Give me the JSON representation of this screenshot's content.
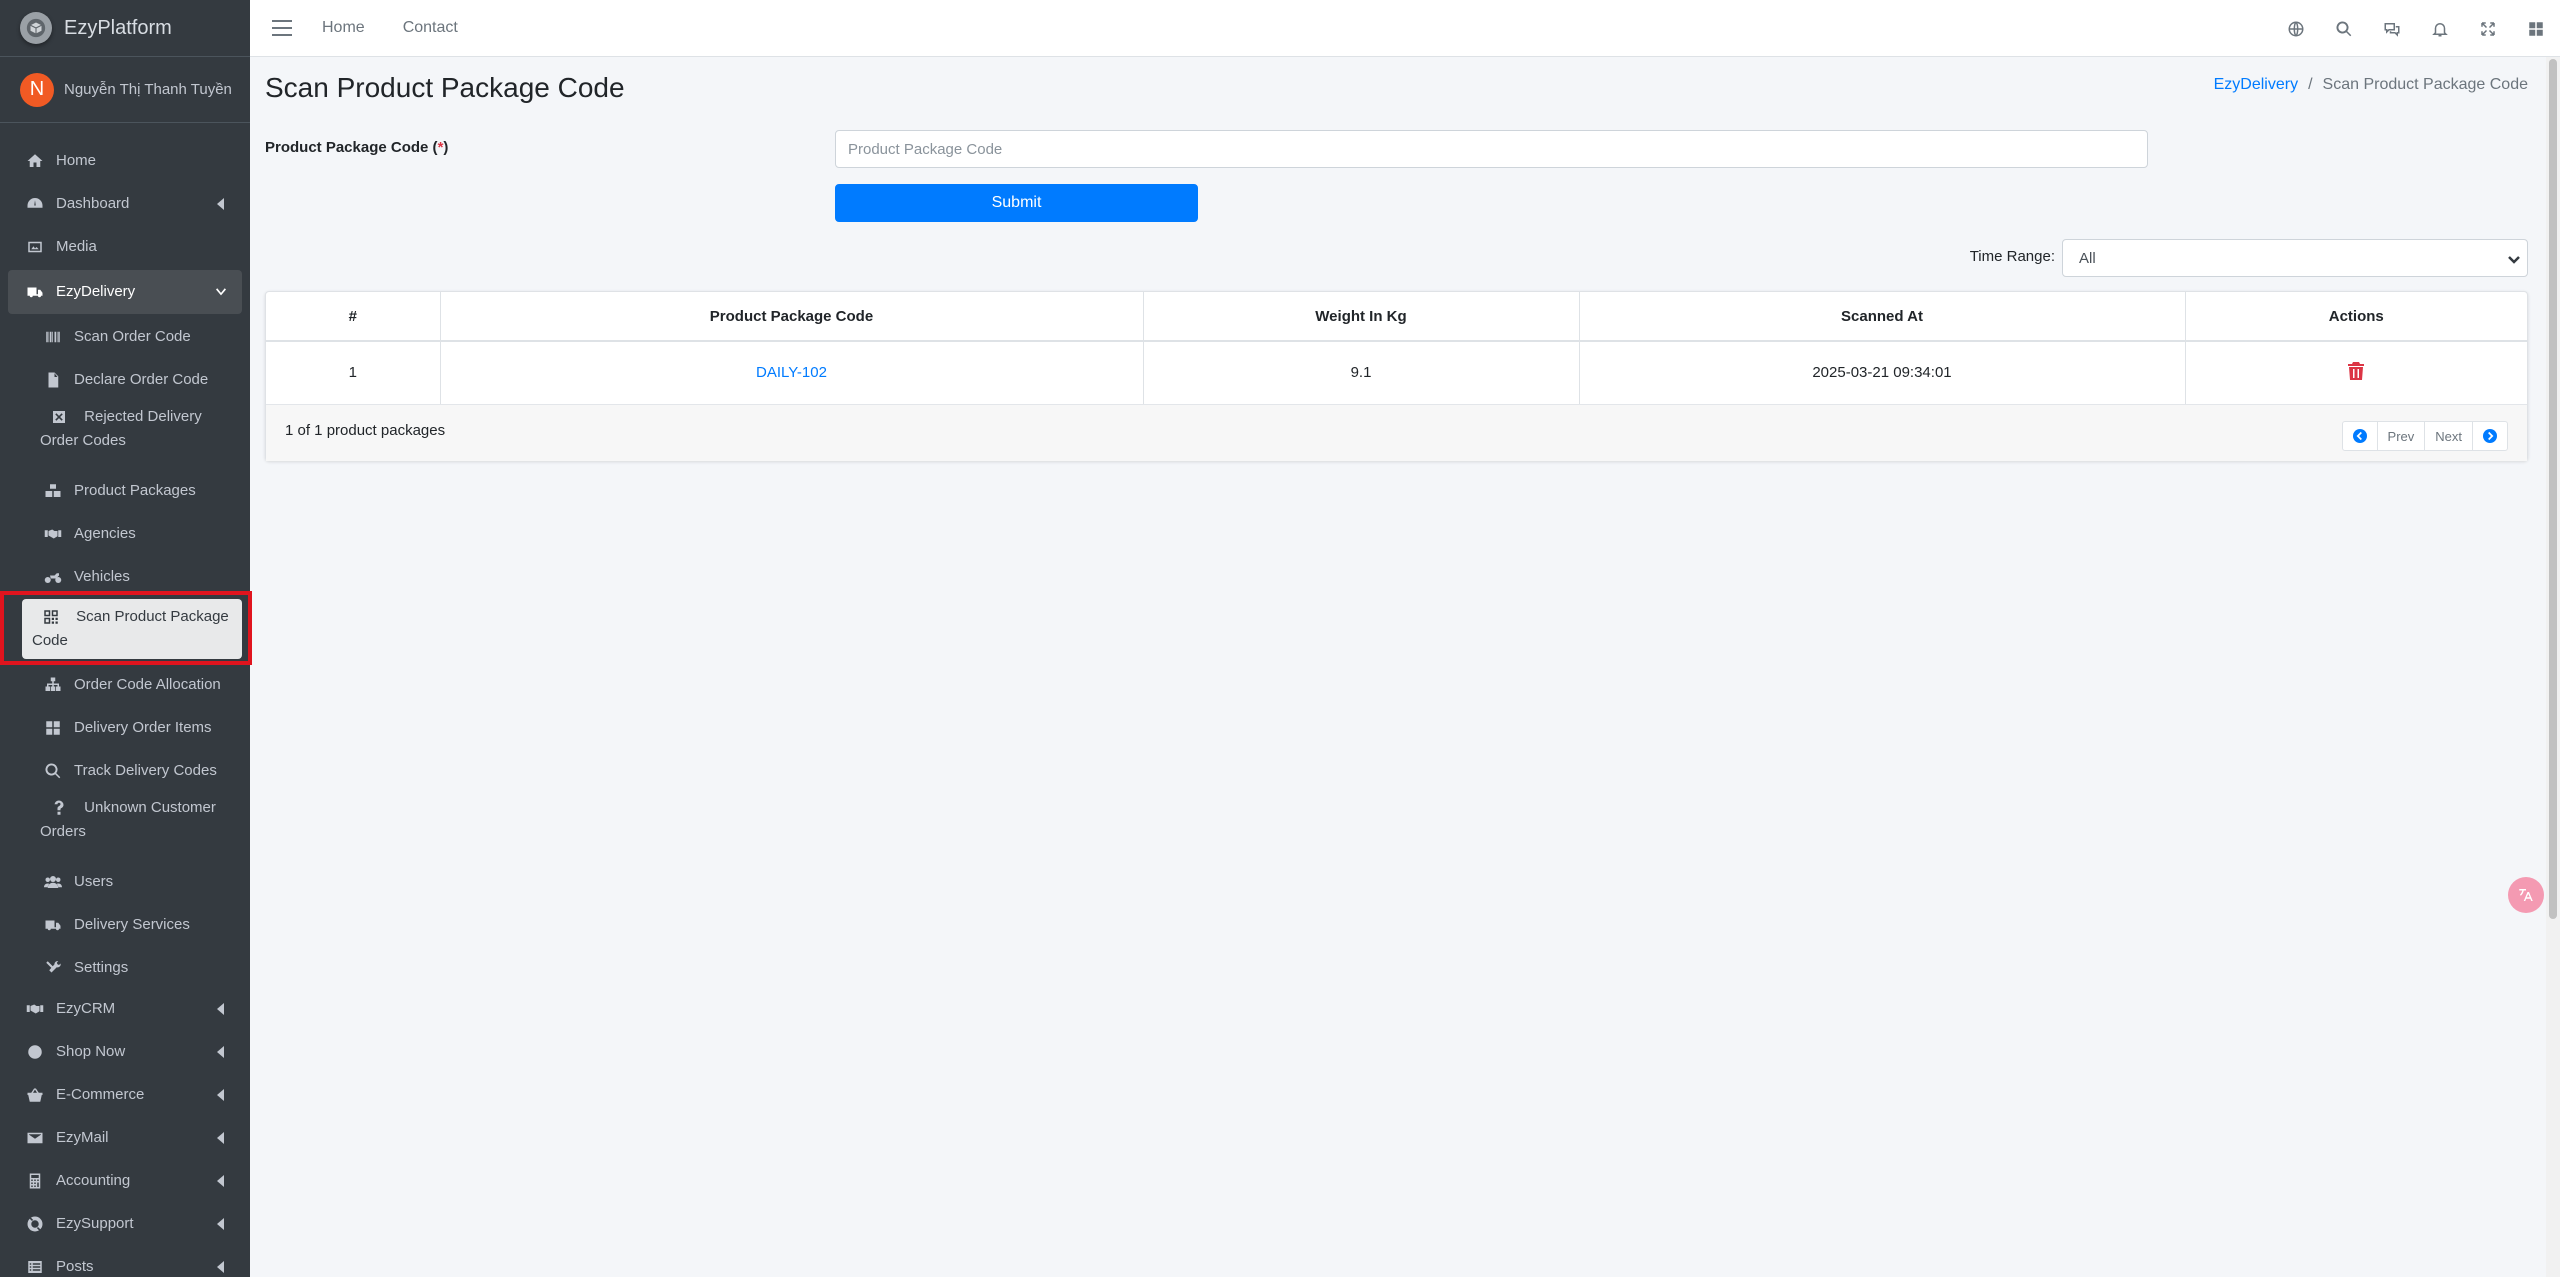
{
  "brand": {
    "name": "EzyPlatform"
  },
  "user": {
    "initial": "N",
    "name": "Nguyễn Thị Thanh Tuyền"
  },
  "sidebar": {
    "items": [
      {
        "label": "Home",
        "icon": "home-icon"
      },
      {
        "label": "Dashboard",
        "icon": "dashboard-icon"
      },
      {
        "label": "Media",
        "icon": "image-icon"
      },
      {
        "label": "EzyDelivery",
        "icon": "truck-icon"
      },
      {
        "label": "Scan Order Code",
        "icon": "barcode-icon"
      },
      {
        "label": "Declare Order Code",
        "icon": "file-icon"
      },
      {
        "label": "Rejected Delivery Order Codes",
        "icon": "x-square-icon"
      },
      {
        "label": "Product Packages",
        "icon": "boxes-icon"
      },
      {
        "label": "Agencies",
        "icon": "handshake-icon"
      },
      {
        "label": "Vehicles",
        "icon": "motorcycle-icon"
      },
      {
        "label": "Scan Product Package Code",
        "icon": "qrcode-icon"
      },
      {
        "label": "Order Code Allocation",
        "icon": "sitemap-icon"
      },
      {
        "label": "Delivery Order Items",
        "icon": "grid-icon"
      },
      {
        "label": "Track Delivery Codes",
        "icon": "search-icon"
      },
      {
        "label": "Unknown Customer Orders",
        "icon": "question-icon"
      },
      {
        "label": "Users",
        "icon": "users-icon"
      },
      {
        "label": "Delivery Services",
        "icon": "truck-icon"
      },
      {
        "label": "Settings",
        "icon": "tools-icon"
      },
      {
        "label": "EzyCRM",
        "icon": "handshake-icon"
      },
      {
        "label": "Shop Now",
        "icon": "circle-icon"
      },
      {
        "label": "E-Commerce",
        "icon": "basket-icon"
      },
      {
        "label": "EzyMail",
        "icon": "envelope-icon"
      },
      {
        "label": "Accounting",
        "icon": "calculator-icon"
      },
      {
        "label": "EzySupport",
        "icon": "lifebuoy-icon"
      },
      {
        "label": "Posts",
        "icon": "list-icon"
      }
    ]
  },
  "topbar": {
    "home": "Home",
    "contact": "Contact"
  },
  "page": {
    "title": "Scan Product Package Code",
    "breadcrumb": {
      "parent": "EzyDelivery",
      "sep": "/",
      "current": "Scan Product Package Code"
    }
  },
  "form": {
    "label": "Product Package Code",
    "required_open": " (",
    "required_mark": "*",
    "required_close": ")",
    "placeholder": "Product Package Code",
    "value": "",
    "submit": "Submit"
  },
  "filter": {
    "label": "Time Range:",
    "selected": "All"
  },
  "table": {
    "headers": {
      "index": "#",
      "code": "Product Package Code",
      "weight": "Weight In Kg",
      "scanned": "Scanned At",
      "actions": "Actions"
    },
    "rows": [
      {
        "index": "1",
        "code": "DAILY-102",
        "weight": "9.1",
        "scanned": "2025-03-21 09:34:01"
      }
    ],
    "count_text": "1 of 1 product packages",
    "prev": "Prev",
    "next": "Next"
  },
  "colors": {
    "primary": "#007bff",
    "danger": "#dc3545",
    "sidebar": "#343a40",
    "highlight": "#e0141e"
  }
}
